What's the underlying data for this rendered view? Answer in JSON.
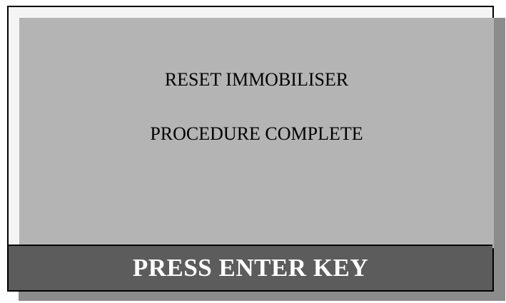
{
  "screen": {
    "message_lines": [
      "RESET IMMOBILISER",
      "PROCEDURE COMPLETE"
    ],
    "prompt": "PRESS ENTER KEY"
  },
  "colors": {
    "panel": "#b4b4b4",
    "prompt_bar": "#5c5c5c",
    "prompt_text": "#ffffff",
    "frame_border": "#000000",
    "shadow": "#8c8c8c"
  }
}
